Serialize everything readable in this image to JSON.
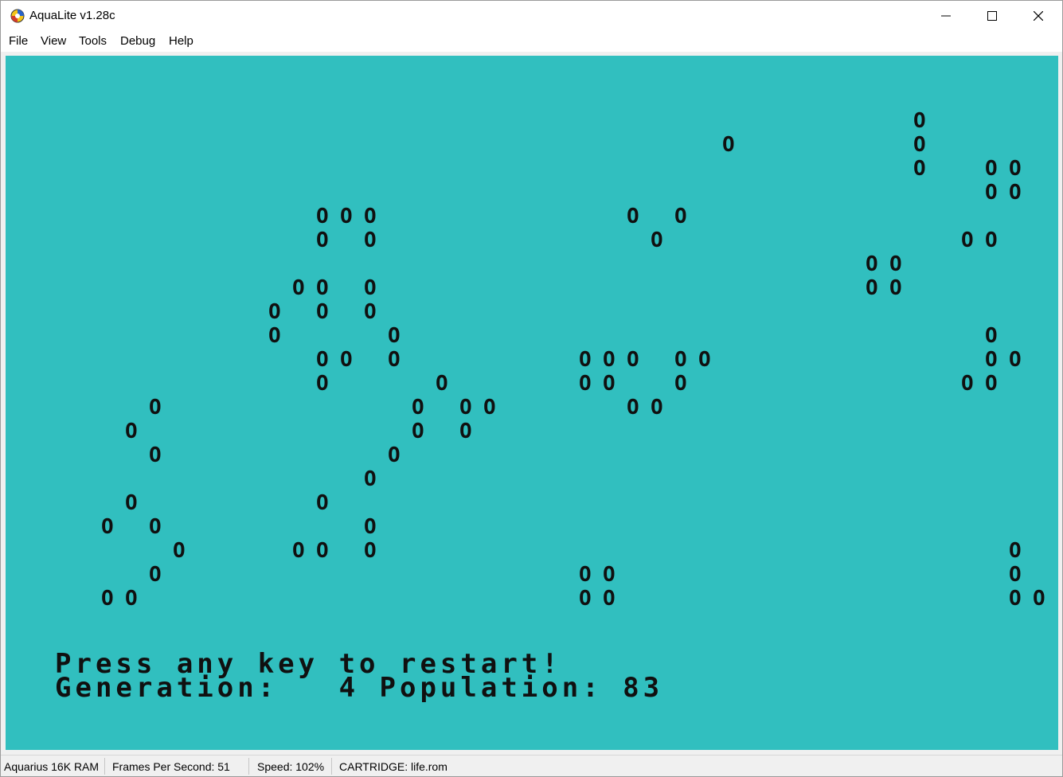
{
  "window": {
    "title": "AquaLite v1.28c"
  },
  "menu": [
    "File",
    "View",
    "Tools",
    "Debug",
    "Help"
  ],
  "screen": {
    "background_color": "#31bfbf",
    "cell_char": "O",
    "cells": [
      [
        28,
        3
      ],
      [
        36,
        2
      ],
      [
        36,
        3
      ],
      [
        36,
        4
      ],
      [
        39,
        4
      ],
      [
        40,
        4
      ],
      [
        39,
        5
      ],
      [
        40,
        5
      ],
      [
        11,
        6
      ],
      [
        12,
        6
      ],
      [
        13,
        6
      ],
      [
        24,
        6
      ],
      [
        26,
        6
      ],
      [
        11,
        7
      ],
      [
        13,
        7
      ],
      [
        25,
        7
      ],
      [
        38,
        7
      ],
      [
        39,
        7
      ],
      [
        34,
        8
      ],
      [
        35,
        8
      ],
      [
        34,
        9
      ],
      [
        35,
        9
      ],
      [
        10,
        9
      ],
      [
        11,
        9
      ],
      [
        13,
        9
      ],
      [
        9,
        10
      ],
      [
        11,
        10
      ],
      [
        13,
        10
      ],
      [
        9,
        11
      ],
      [
        14,
        11
      ],
      [
        39,
        11
      ],
      [
        11,
        12
      ],
      [
        12,
        12
      ],
      [
        14,
        12
      ],
      [
        22,
        12
      ],
      [
        23,
        12
      ],
      [
        24,
        12
      ],
      [
        26,
        12
      ],
      [
        27,
        12
      ],
      [
        39,
        12
      ],
      [
        40,
        12
      ],
      [
        11,
        13
      ],
      [
        16,
        13
      ],
      [
        22,
        13
      ],
      [
        23,
        13
      ],
      [
        26,
        13
      ],
      [
        38,
        13
      ],
      [
        39,
        13
      ],
      [
        4,
        14
      ],
      [
        15,
        14
      ],
      [
        17,
        14
      ],
      [
        18,
        14
      ],
      [
        24,
        14
      ],
      [
        25,
        14
      ],
      [
        3,
        15
      ],
      [
        15,
        15
      ],
      [
        17,
        15
      ],
      [
        4,
        16
      ],
      [
        14,
        16
      ],
      [
        13,
        17
      ],
      [
        3,
        18
      ],
      [
        11,
        18
      ],
      [
        2,
        19
      ],
      [
        4,
        19
      ],
      [
        13,
        19
      ],
      [
        5,
        20
      ],
      [
        10,
        20
      ],
      [
        11,
        20
      ],
      [
        13,
        20
      ],
      [
        40,
        20
      ],
      [
        4,
        21
      ],
      [
        22,
        21
      ],
      [
        23,
        21
      ],
      [
        40,
        21
      ],
      [
        2,
        22
      ],
      [
        3,
        22
      ],
      [
        22,
        22
      ],
      [
        23,
        22
      ],
      [
        40,
        22
      ],
      [
        41,
        22
      ]
    ],
    "messages": {
      "line1": "Press any key to restart!",
      "line2": "Generation:   4 Population: 83"
    }
  },
  "status": {
    "ram": "Aquarius 16K RAM",
    "fps": "Frames Per Second: 51",
    "speed": "Speed: 102%",
    "cartridge": "CARTRIDGE: life.rom"
  }
}
